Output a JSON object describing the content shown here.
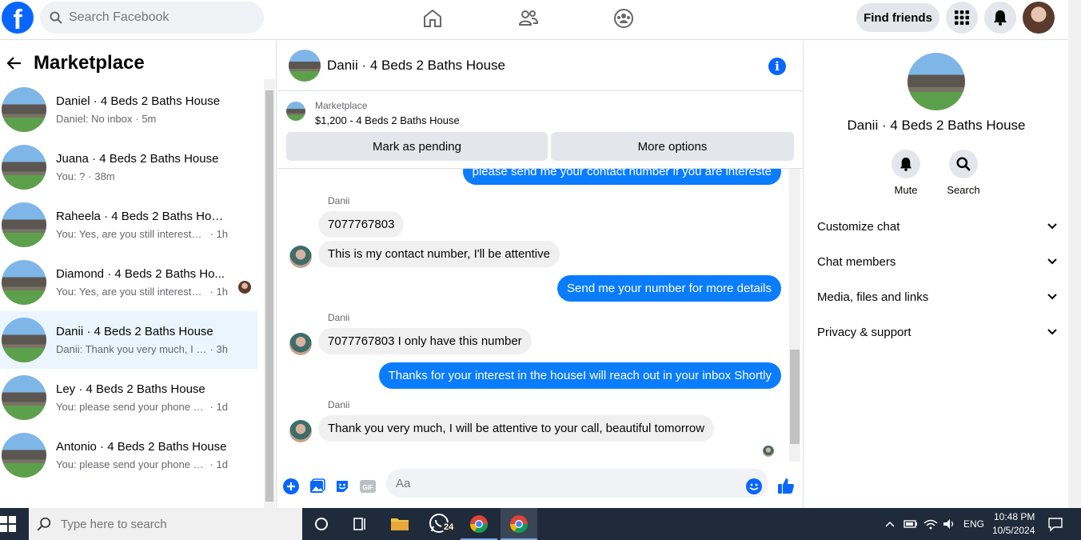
{
  "header": {
    "logo": "f",
    "search_placeholder": "Search Facebook",
    "find_friends": "Find friends"
  },
  "left": {
    "title": "Marketplace",
    "conversations": [
      {
        "title": "Daniel · 4 Beds 2 Baths House",
        "msg": "Daniel: No inbox",
        "time": "· 5m"
      },
      {
        "title": "Juana · 4 Beds 2 Baths House",
        "msg": "You: ?",
        "time": "· 38m"
      },
      {
        "title": "Raheela · 4 Beds 2 Baths House",
        "msg": "You: Yes, are you still interested?",
        "time": "· 1h"
      },
      {
        "title": "Diamond · 4 Beds 2 Baths Ho...",
        "msg": "You: Yes, are you still interested?",
        "time": "· 1h"
      },
      {
        "title": "Danii · 4 Beds 2 Baths House",
        "msg": "Danii: Thank you very much, I will b...",
        "time": "· 3h"
      },
      {
        "title": "Ley · 4 Beds 2 Baths House",
        "msg": "You: please send your phone num...",
        "time": "· 1d"
      },
      {
        "title": "Antonio · 4 Beds 2 Baths House",
        "msg": "You: please send your phone num...",
        "time": "· 1d"
      }
    ]
  },
  "chat": {
    "title": "Danii · 4 Beds 2 Baths House",
    "listing_label": "Marketplace",
    "listing_price": "$1,200 - 4 Beds 2 Baths House",
    "mark_pending": "Mark as pending",
    "more_options": "More options",
    "messages": {
      "m0": "please send me your contact number if you are intereste",
      "s1": "Danii",
      "m1": "7077767803",
      "m2": "This is my contact number, I'll be attentive",
      "m3": "Send me your number for more details",
      "s2": "Danii",
      "m4": "7077767803 I only have this number",
      "m5": "Thanks for your interest in the houseI will reach out in your inbox Shortly",
      "s3": "Danii",
      "m6": "Thank you very much, I will be attentive to your call, beautiful tomorrow"
    },
    "input_placeholder": "Aa"
  },
  "right": {
    "title": "Danii · 4 Beds 2 Baths House",
    "mute": "Mute",
    "search": "Search",
    "rows": [
      "Customize chat",
      "Chat members",
      "Media, files and links",
      "Privacy & support"
    ]
  },
  "taskbar": {
    "search_placeholder": "Type here to search",
    "whatsapp_badge": "24",
    "lang": "ENG",
    "time": "10:48 PM",
    "date": "10/5/2024"
  },
  "colors": {
    "brand": "#0866ff",
    "bubble_out": "#0a7cff",
    "active_row": "#ebf5ff"
  }
}
